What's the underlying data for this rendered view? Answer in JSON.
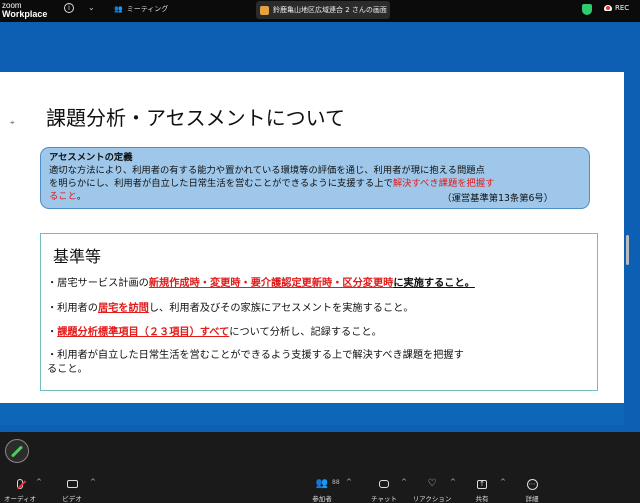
{
  "topbar": {
    "logo_line1": "zoom",
    "logo_line2": "Workplace",
    "info_icon": "info-icon",
    "meeting_label": "ミーティング",
    "share_tab_label": "鈴鹿亀山地区広域連合 2 さんの画面",
    "rec_label": "REC"
  },
  "slide": {
    "title": "課題分析・アセスメントについて",
    "definition": {
      "heading": "アセスメントの定義",
      "line1": "適切な方法により、利用者の有する能力や置かれている環境等の評価を通じ、利用者が現に抱える問題点",
      "line2_plain": "を明らかにし、利用者が自立した日常生活を営むことができるように支援する上で",
      "line2_red": "解決すべき課題を把握す",
      "line3_red": "ること",
      "line3_plain": "。",
      "reference": "（運営基準第13条第6号）"
    },
    "standards": {
      "heading": "基準等",
      "item1_prefix": "・居宅サービス計画の",
      "item1_red": "新規作成時・変更時・要介護認定更新時・区分変更時",
      "item1_suffix": "に実施すること。",
      "item2_prefix": "・利用者の",
      "item2_red": "居宅を訪問",
      "item2_suffix": "し、利用者及びその家族にアセスメントを実施すること。",
      "item3_prefix": "・",
      "item3_red": "課題分析標準項目（２３項目）すべて",
      "item3_suffix": "について分析し、記録すること。",
      "item4_line1": "・利用者が自立した日常生活を営むことができるよう支援する上で解決すべき課題を把握す",
      "item4_line2": "ること。"
    }
  },
  "toolbar": {
    "audio": "オーディオ",
    "video": "ビデオ",
    "participants": "参加者",
    "participants_count": "88",
    "chat": "チャット",
    "reactions": "リアクション",
    "share": "共有",
    "more": "詳細"
  },
  "colors": {
    "accent_blue": "#0d5fb4",
    "highlight_red": "#e21b1b",
    "definition_box": "#9ec7ea"
  }
}
